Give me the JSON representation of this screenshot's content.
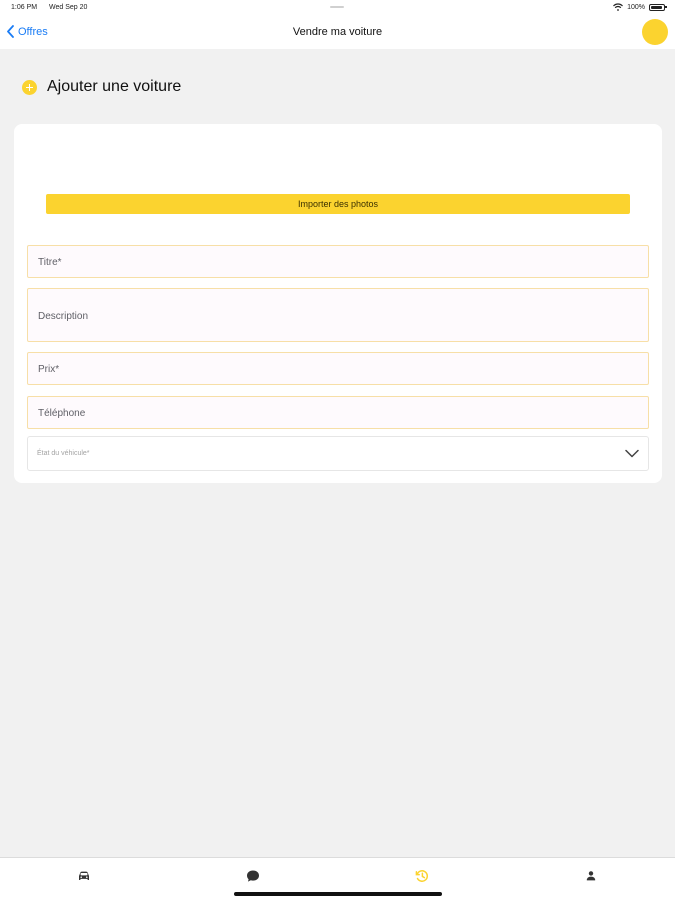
{
  "status_bar": {
    "time": "1:06 PM",
    "date": "Wed Sep 20",
    "battery": "100%"
  },
  "nav": {
    "back_label": "Offres",
    "title": "Vendre ma voiture",
    "accent_color": "#FBD32F",
    "link_color": "#1A7CF5"
  },
  "section": {
    "title": "Ajouter une voiture",
    "icon": "plus-circle-icon"
  },
  "form": {
    "import_button_label": "Importer des photos",
    "title_placeholder": "Titre*",
    "description_placeholder": "Description",
    "price_placeholder": "Prix*",
    "phone_placeholder": "Téléphone",
    "condition_placeholder": "État du véhicule*"
  },
  "tabs": [
    {
      "icon": "car-icon",
      "active": false
    },
    {
      "icon": "chat-bubble-icon",
      "active": false
    },
    {
      "icon": "history-icon",
      "active": true
    },
    {
      "icon": "person-icon",
      "active": false
    }
  ]
}
